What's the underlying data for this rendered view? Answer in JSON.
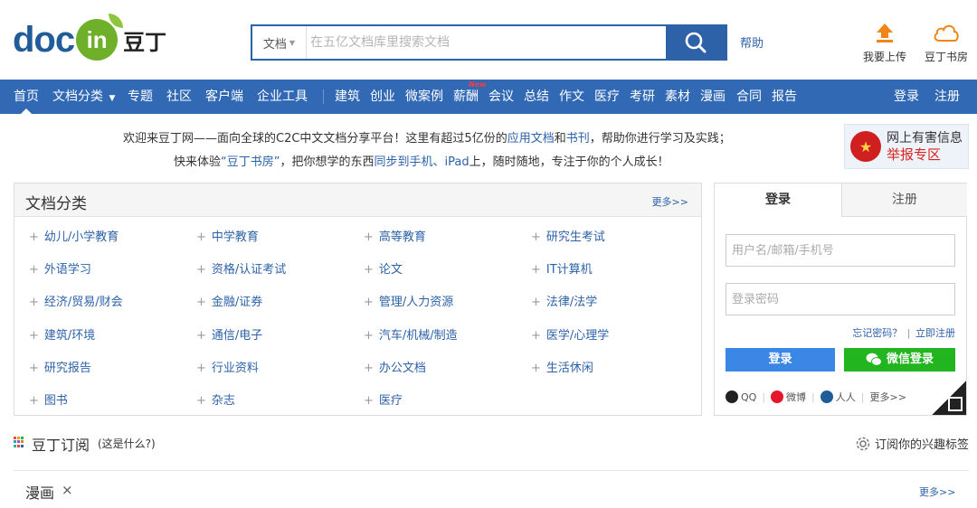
{
  "header": {
    "logo_brand": "doc",
    "logo_in": "in",
    "logo_cn": "豆丁",
    "search": {
      "type_label": "文档",
      "placeholder": "在五亿文档库里搜索文档"
    },
    "help": "帮助",
    "upload_label": "我要上传",
    "bookroom_label": "豆丁书房"
  },
  "nav": {
    "items": [
      "首页",
      "文档分类",
      "专题",
      "社区",
      "客户端",
      "企业工具",
      "建筑",
      "创业",
      "微案例",
      "薪酬",
      "会议",
      "总结",
      "作文",
      "医疗",
      "考研",
      "素材",
      "漫画",
      "合同",
      "报告"
    ],
    "new_badge": "New",
    "login": "登录",
    "register": "注册"
  },
  "welcome": {
    "line1_a": "欢迎来豆丁网——面向全球的C2C中文文档分享平台！这里有超过5亿份的",
    "line1_link1": "应用文档",
    "line1_and": "和",
    "line1_link2": "书刊",
    "line1_b": "，帮助你进行学习及实践；",
    "line2_a": "快来体验",
    "line2_link1": "“豆丁书房”",
    "line2_b": "，把你想学的东西",
    "line2_link2": "同步到手机、iPad",
    "line2_c": "上，随时随地，专注于你的个人成长！"
  },
  "report": {
    "line1": "网上有害信息",
    "line2": "举报专区"
  },
  "categories": {
    "title": "文档分类",
    "more": "更多>>",
    "items": [
      "幼儿/小学教育",
      "中学教育",
      "高等教育",
      "研究生考试",
      "外语学习",
      "资格/认证考试",
      "论文",
      "IT计算机",
      "经济/贸易/财会",
      "金融/证券",
      "管理/人力资源",
      "法律/法学",
      "建筑/环境",
      "通信/电子",
      "汽车/机械/制造",
      "医学/心理学",
      "研究报告",
      "行业资料",
      "办公文档",
      "生活休闲",
      "图书",
      "杂志",
      "医疗"
    ]
  },
  "login": {
    "tab_login": "登录",
    "tab_register": "注册",
    "username_placeholder": "用户名/邮箱/手机号",
    "password_placeholder": "登录密码",
    "forgot": "忘记密码？",
    "sep": "|",
    "register_now": "立即注册",
    "login_button": "登录",
    "wechat_button": "微信登录",
    "social": {
      "qq": "QQ",
      "weibo": "微博",
      "renren": "人人",
      "more": "更多>>"
    }
  },
  "subscription": {
    "title": "豆丁订阅",
    "what": "(这是什么?)",
    "tags": "订阅你的兴趣标签"
  },
  "manga": {
    "title": "漫画",
    "close": "×",
    "more": "更多>>"
  },
  "colors": {
    "nav_blue": "#3169b4",
    "link_blue": "#2d62a8",
    "login_blue": "#3a87e5",
    "wechat_green": "#22b51f",
    "report_red": "#d9231f"
  }
}
